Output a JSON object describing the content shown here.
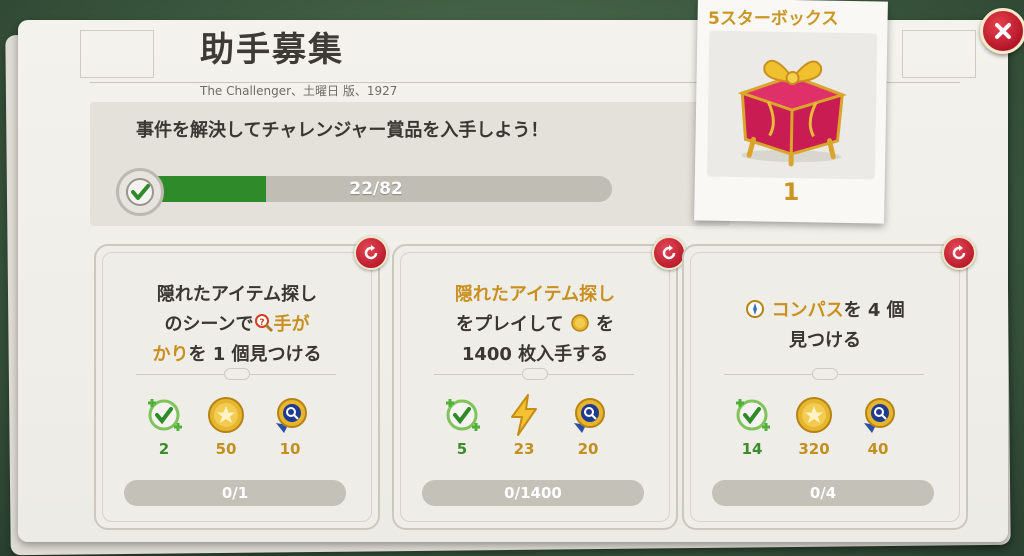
{
  "header": {
    "title": "助手募集",
    "byline": "The Challenger、土曜日 版、1927"
  },
  "objective": {
    "text": "事件を解決してチャレンジャー賞品を入手しよう！",
    "progress_text": "22/82",
    "progress_fraction": 0.268
  },
  "prize": {
    "title": "5スターボックス",
    "count": "1"
  },
  "tasks": [
    {
      "line1": "隠れたアイテム探し",
      "line2_pre": "のシーンで",
      "line2_hl": "手が",
      "line3_hl": "かり",
      "line3_post": "を 1 個見つける",
      "rewards": [
        {
          "icon": "check-token-icon",
          "value": "2"
        },
        {
          "icon": "coin-icon",
          "value": "50"
        },
        {
          "icon": "magnifier-medal-icon",
          "value": "10"
        }
      ],
      "progress": "0/1"
    },
    {
      "line1_hl": "隠れたアイテム探し",
      "line2_pre": "をプレイして",
      "line2_post": "を",
      "line3": "1400 枚入手する",
      "rewards": [
        {
          "icon": "check-token-icon",
          "value": "5"
        },
        {
          "icon": "lightning-icon",
          "value": "23"
        },
        {
          "icon": "magnifier-medal-icon",
          "value": "20"
        }
      ],
      "progress": "0/1400"
    },
    {
      "line1_hl": "コンパス",
      "line1_post": "を 4 個",
      "line2": "見つける",
      "rewards": [
        {
          "icon": "check-token-icon",
          "value": "14"
        },
        {
          "icon": "coin-icon",
          "value": "320"
        },
        {
          "icon": "magnifier-medal-icon",
          "value": "40"
        }
      ],
      "progress": "0/4"
    }
  ],
  "colors": {
    "progress_green": "#2f8a2a",
    "accent_gold": "#c99624",
    "close_red": "#c01a2c"
  }
}
